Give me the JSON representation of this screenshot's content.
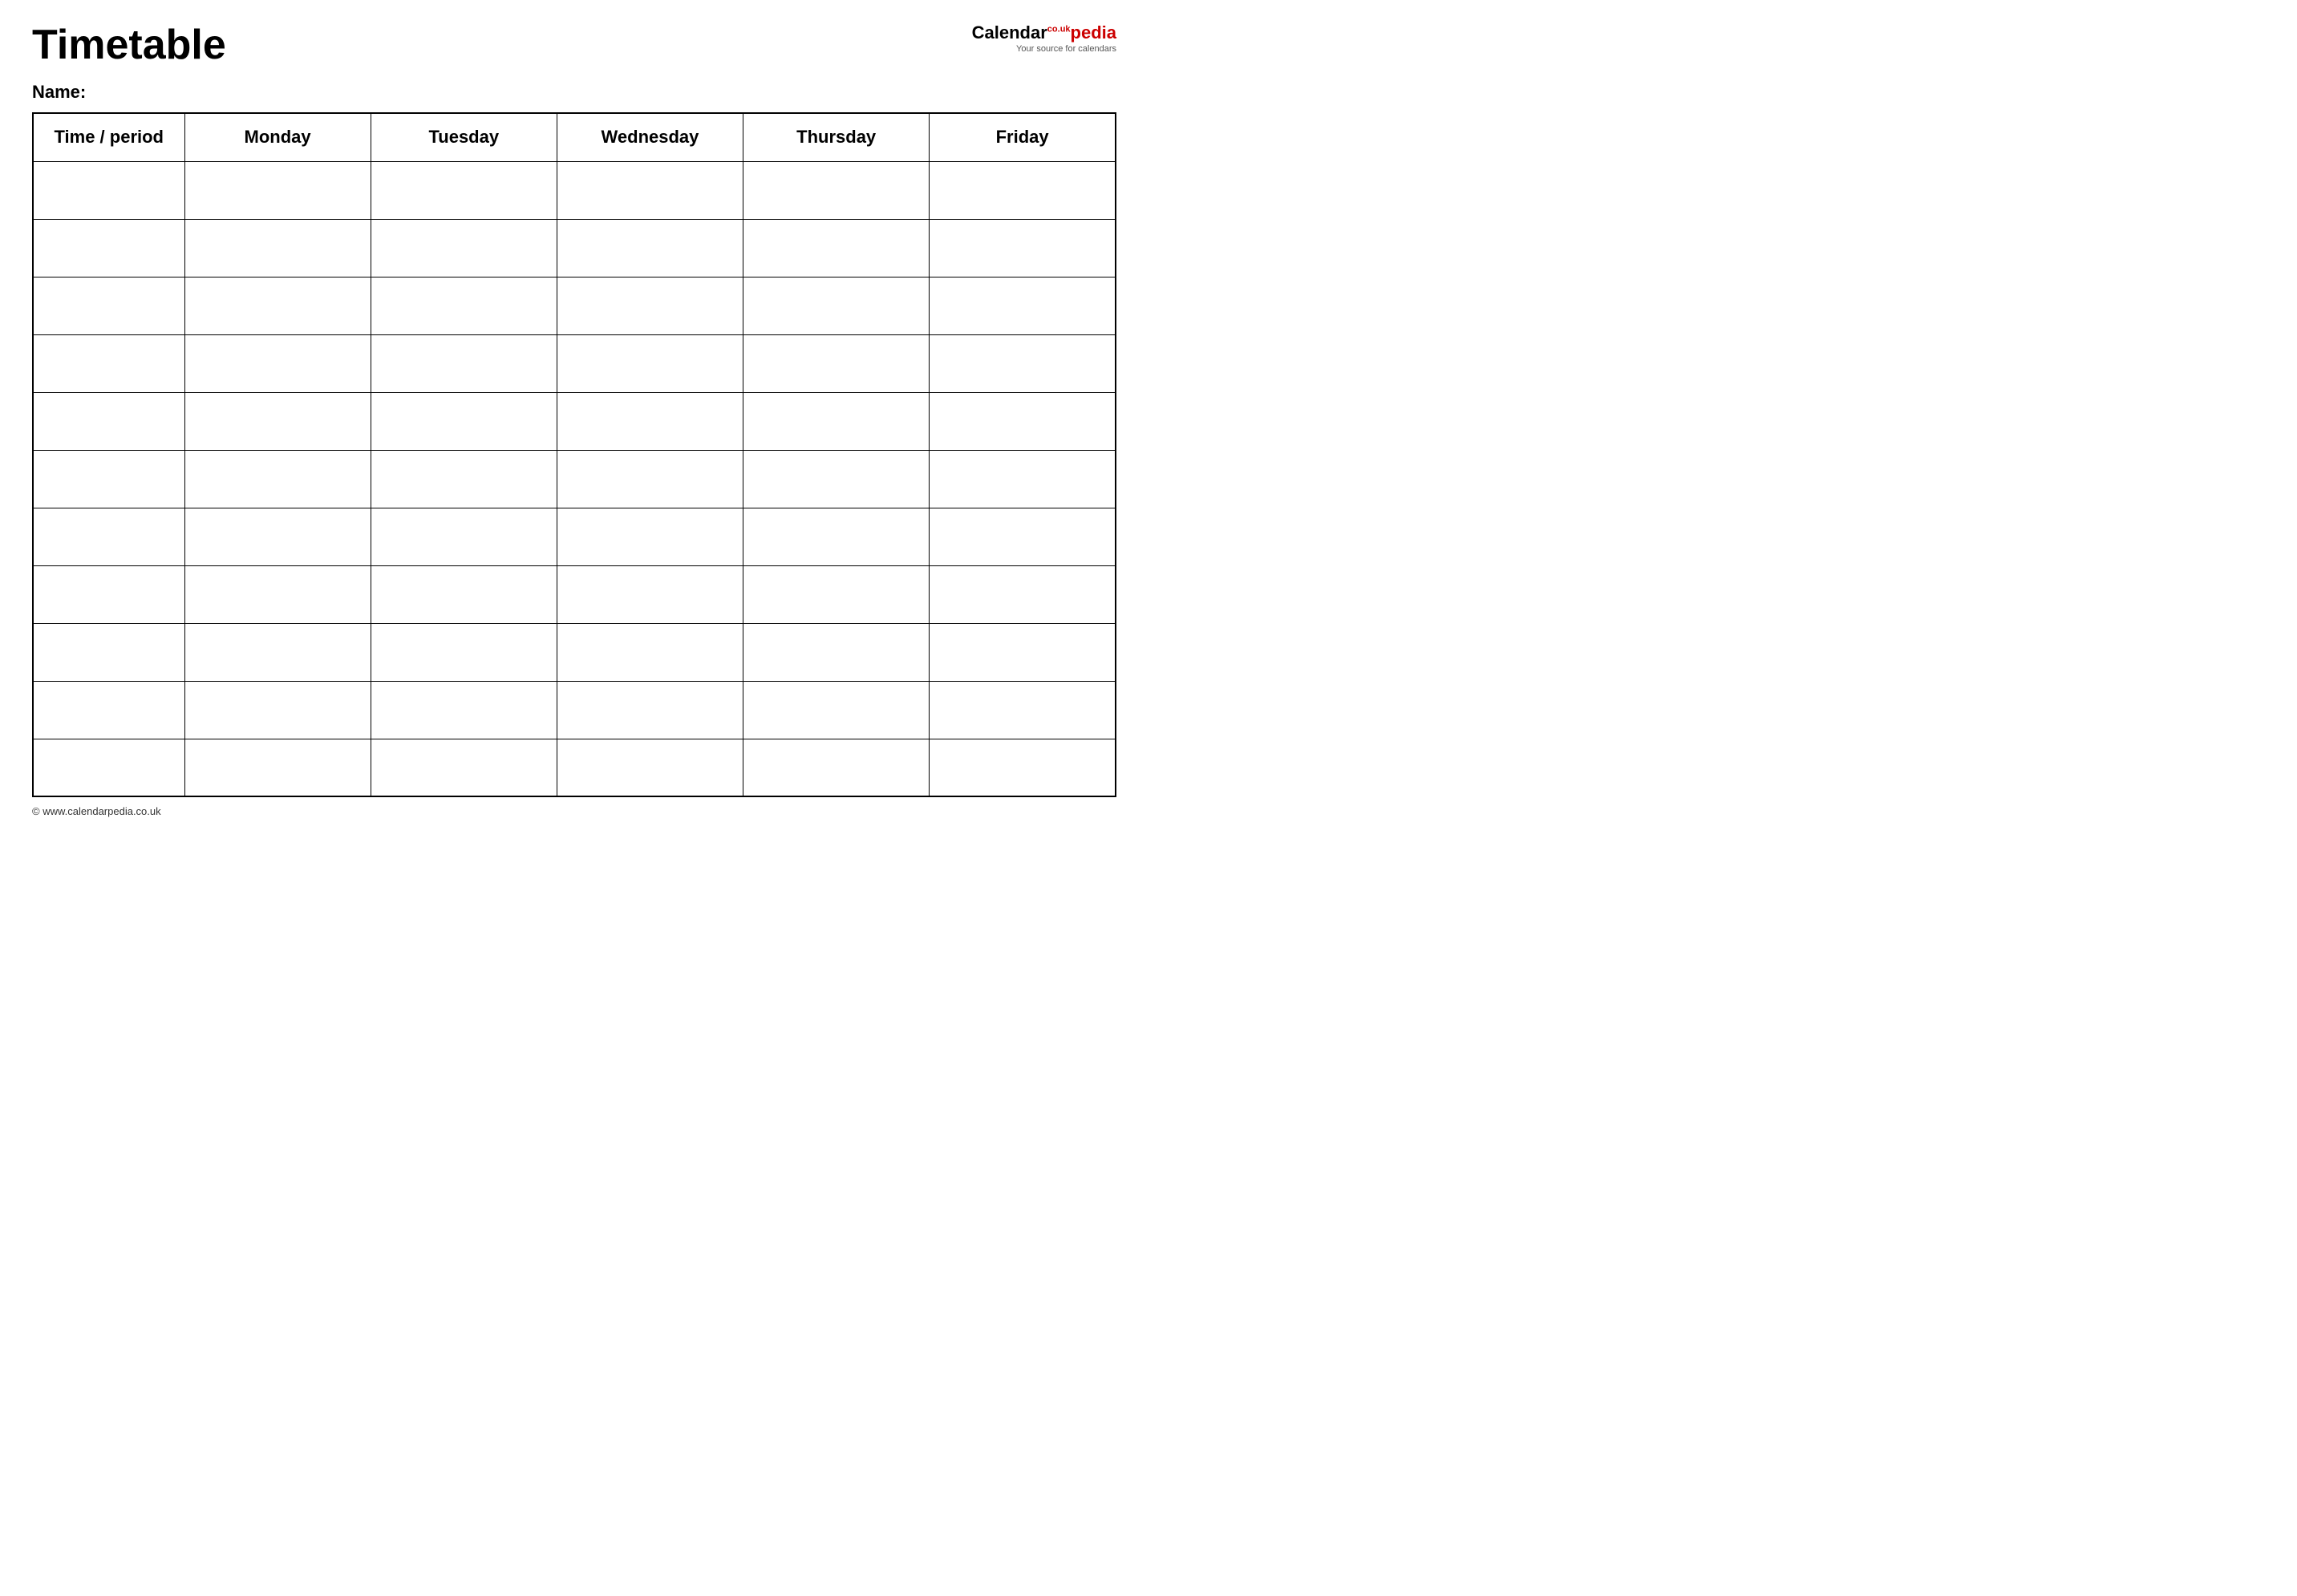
{
  "header": {
    "title": "Timetable",
    "logo": {
      "calendar_text": "Calendar",
      "pedia_text": "pedia",
      "co_uk": "co.uk",
      "tagline": "Your source for calendars"
    }
  },
  "name_label": "Name:",
  "table": {
    "headers": [
      "Time / period",
      "Monday",
      "Tuesday",
      "Wednesday",
      "Thursday",
      "Friday"
    ],
    "rows": 11
  },
  "footer": {
    "url": "www.calendarpedia.co.uk"
  }
}
